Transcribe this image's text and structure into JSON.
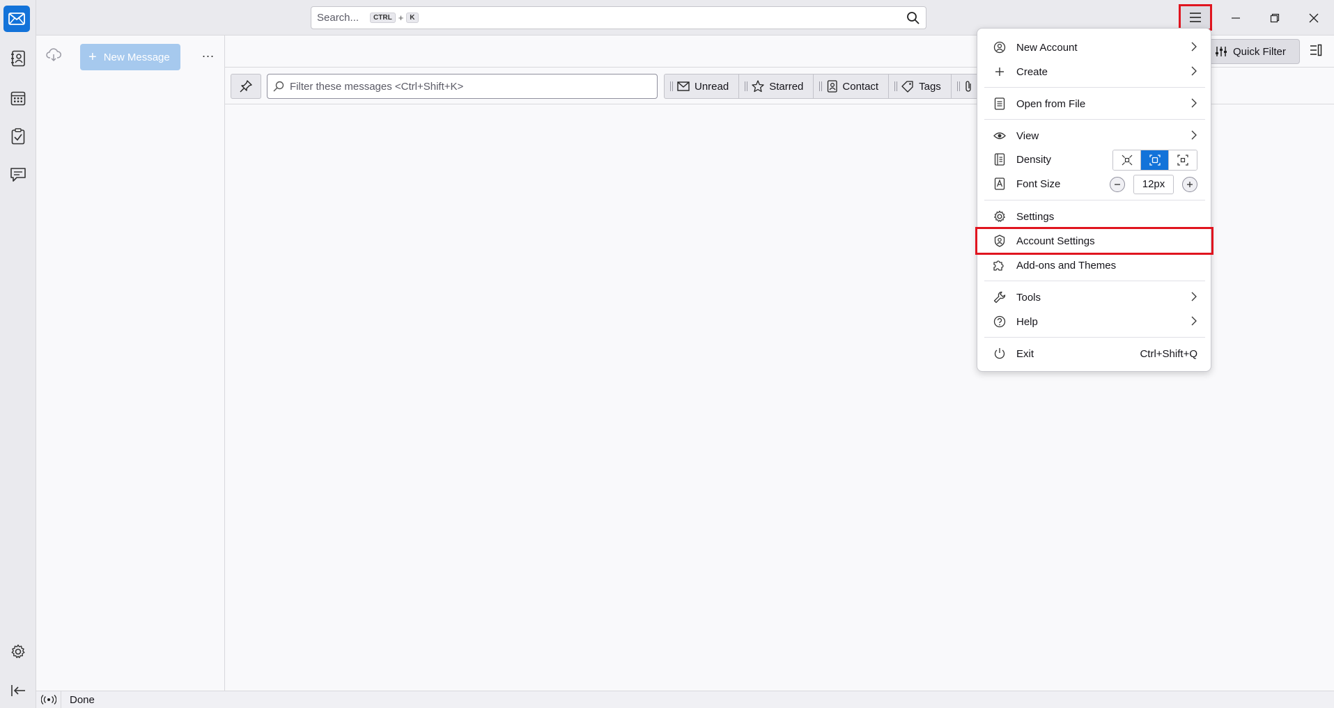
{
  "search": {
    "placeholder": "Search...",
    "shortcut_key1": "CTRL",
    "plus": "+",
    "shortcut_key2": "K"
  },
  "folder_pane": {
    "new_message_label": "New Message",
    "more_label": "..."
  },
  "main": {
    "quick_filter_label": "Quick Filter",
    "filter_placeholder": "Filter these messages <Ctrl+Shift+K>",
    "filters": [
      {
        "label": "Unread",
        "icon": "envelope-icon"
      },
      {
        "label": "Starred",
        "icon": "star-icon"
      },
      {
        "label": "Contact",
        "icon": "contact-icon"
      },
      {
        "label": "Tags",
        "icon": "tag-icon"
      }
    ]
  },
  "status": {
    "text": "Done"
  },
  "app_menu": {
    "new_account": "New Account",
    "create": "Create",
    "open_from_file": "Open from File",
    "view": "View",
    "density": "Density",
    "font_size": "Font Size",
    "font_size_value": "12px",
    "settings": "Settings",
    "account_settings": "Account Settings",
    "addons_themes": "Add-ons and Themes",
    "tools": "Tools",
    "help": "Help",
    "exit": "Exit",
    "exit_shortcut": "Ctrl+Shift+Q"
  },
  "colors": {
    "accent": "#1373d9",
    "highlight": "#e0151f",
    "new_message_bg": "#a6c9ee"
  }
}
